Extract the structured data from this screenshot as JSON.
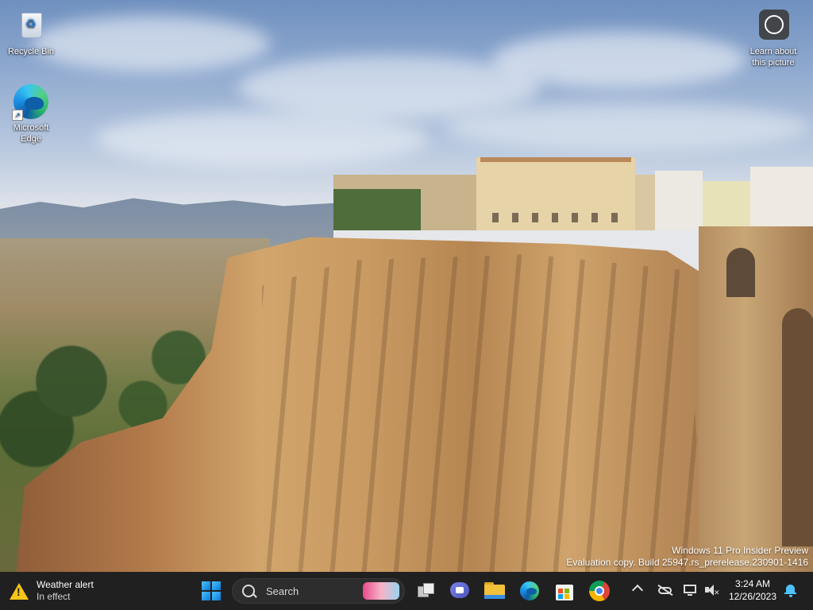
{
  "desktop": {
    "icons": [
      {
        "label": "Recycle Bin",
        "icon": "recycle-bin-icon"
      },
      {
        "label": "Microsoft Edge",
        "icon": "edge-icon"
      },
      {
        "label": "Learn about this picture",
        "icon": "learn-about-picture-icon"
      }
    ],
    "watermark": {
      "line1": "Windows 11 Pro Insider Preview",
      "line2": "Evaluation copy. Build 25947.rs_prerelease.230901-1416"
    }
  },
  "taskbar": {
    "weather": {
      "title": "Weather alert",
      "subtitle": "In effect",
      "icon": "warning-icon",
      "color": "#f5c518"
    },
    "search": {
      "placeholder": "Search"
    },
    "apps": [
      {
        "name": "Task View",
        "icon": "task-view-icon"
      },
      {
        "name": "Chat",
        "icon": "chat-icon"
      },
      {
        "name": "File Explorer",
        "icon": "file-explorer-icon"
      },
      {
        "name": "Microsoft Edge",
        "icon": "edge-icon"
      },
      {
        "name": "Microsoft Store",
        "icon": "store-icon"
      },
      {
        "name": "Google Chrome",
        "icon": "chrome-icon"
      }
    ],
    "tray": {
      "time": "3:24 AM",
      "date": "12/26/2023",
      "icons": [
        "chevron-up-icon",
        "cloud-off-icon",
        "network-icon",
        "volume-icon",
        "notification-bell-icon"
      ]
    },
    "colors": {
      "background": "#202020",
      "accent": "#0a78d4"
    }
  }
}
